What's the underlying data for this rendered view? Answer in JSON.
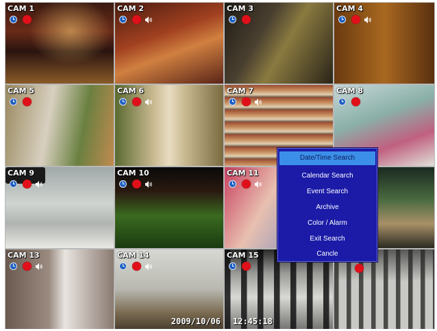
{
  "cameras": [
    {
      "label": "CAM 1",
      "audio": false
    },
    {
      "label": "CAM 2",
      "audio": true
    },
    {
      "label": "CAM 3",
      "audio": false
    },
    {
      "label": "CAM 4",
      "audio": true
    },
    {
      "label": "CAM 5",
      "audio": false
    },
    {
      "label": "CAM 6",
      "audio": true
    },
    {
      "label": "CAM 7",
      "audio": true
    },
    {
      "label": "CAM 8",
      "audio": false
    },
    {
      "label": "CAM 9",
      "audio": true
    },
    {
      "label": "CAM 10",
      "audio": true
    },
    {
      "label": "CAM 11",
      "audio": true
    },
    {
      "label": "",
      "audio": false
    },
    {
      "label": "CAM 13",
      "audio": true
    },
    {
      "label": "CAM 14",
      "audio": true
    },
    {
      "label": "CAM 15",
      "audio": false
    },
    {
      "label": "",
      "audio": false
    }
  ],
  "status": {
    "date": "2009/10/06",
    "time": "12:45:18"
  },
  "search_menu": {
    "items": [
      {
        "label": "Date/Time Search",
        "selected": true
      },
      {
        "label": "Calendar Search",
        "selected": false
      },
      {
        "label": "Event Search",
        "selected": false
      },
      {
        "label": "Archive",
        "selected": false
      },
      {
        "label": "Color / Alarm",
        "selected": false
      },
      {
        "label": "Exit Search",
        "selected": false
      },
      {
        "label": "Cancle",
        "selected": false
      }
    ]
  },
  "icons": {
    "clock": "clock-icon",
    "record": "record-icon",
    "audio": "speaker-icon"
  },
  "colors": {
    "menu_background": "#1b1ba8",
    "menu_selected": "#3c8fe8",
    "record": "#e0101a",
    "clock": "#1d5fc4"
  }
}
